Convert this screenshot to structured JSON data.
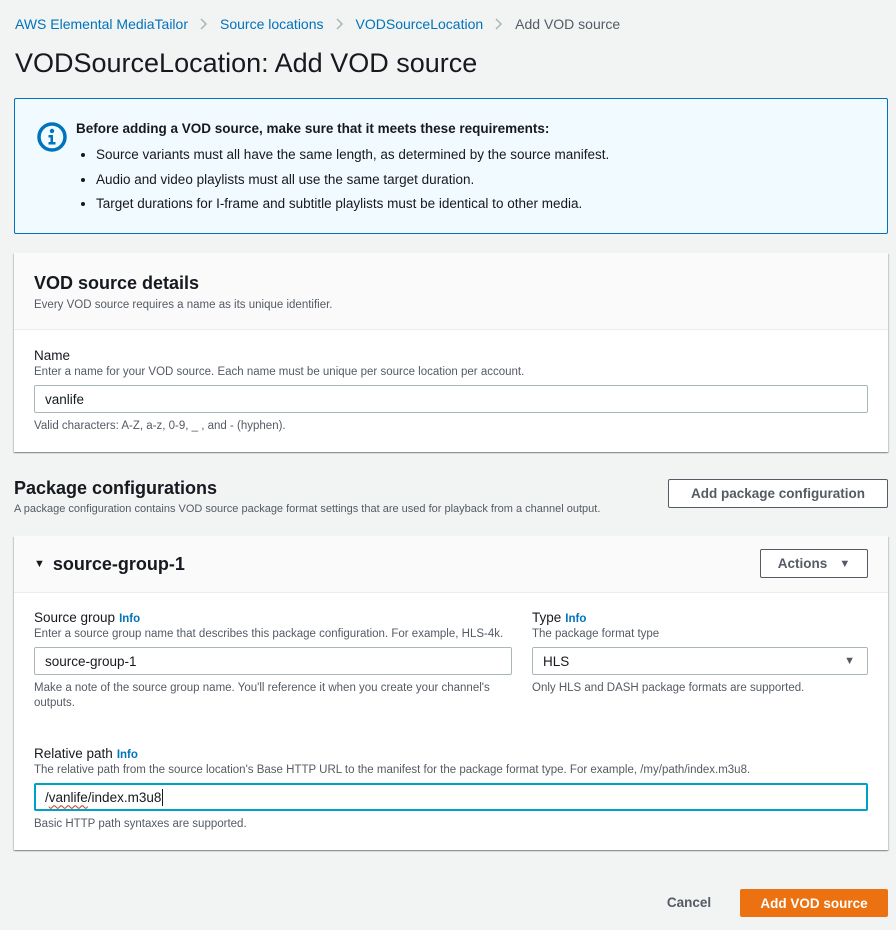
{
  "breadcrumb": {
    "items": [
      {
        "label": "AWS Elemental MediaTailor",
        "link": true
      },
      {
        "label": "Source locations",
        "link": true
      },
      {
        "label": "VODSourceLocation",
        "link": true
      },
      {
        "label": "Add VOD source",
        "link": false
      }
    ]
  },
  "page_title": "VODSourceLocation: Add VOD source",
  "alert": {
    "icon": "info-circle-icon",
    "title": "Before adding a VOD source, make sure that it meets these requirements:",
    "bullets": [
      "Source variants must all have the same length, as determined by the source manifest.",
      "Audio and video playlists must all use the same target duration.",
      "Target durations for I-frame and subtitle playlists must be identical to other media."
    ]
  },
  "details": {
    "title": "VOD source details",
    "description": "Every VOD source requires a name as its unique identifier.",
    "name_field": {
      "label": "Name",
      "description": "Enter a name for your VOD source. Each name must be unique per source location per account.",
      "value": "vanlife",
      "hint": "Valid characters: A-Z, a-z, 0-9, _ , and - (hyphen)."
    }
  },
  "package": {
    "title": "Package configurations",
    "description": "A package configuration contains VOD source package format settings that are used for playback from a channel output.",
    "add_button": "Add package configuration",
    "group": {
      "title": "source-group-1",
      "actions_label": "Actions",
      "source_group": {
        "label": "Source group",
        "info": "Info",
        "description": "Enter a source group name that describes this package configuration. For example, HLS-4k.",
        "value": "source-group-1",
        "hint": "Make a note of the source group name. You'll reference it when you create your channel's outputs."
      },
      "type": {
        "label": "Type",
        "info": "Info",
        "description": "The package format type",
        "selected": "HLS",
        "hint": "Only HLS and DASH package formats are supported."
      },
      "relative_path": {
        "label": "Relative path",
        "info": "Info",
        "description": "The relative path from the source location's Base HTTP URL to the manifest for the package format type. For example, /my/path/index.m3u8.",
        "value_prefix": "/",
        "value_misspelled": "vanlife",
        "value_suffix": "/index.m3u8",
        "hint": "Basic HTTP path syntaxes are supported."
      }
    }
  },
  "footer": {
    "cancel": "Cancel",
    "submit": "Add VOD source"
  },
  "colors": {
    "link": "#0073bb",
    "primary": "#ec7211",
    "focus": "#00a1c9",
    "alert_bg": "#f1faff"
  }
}
